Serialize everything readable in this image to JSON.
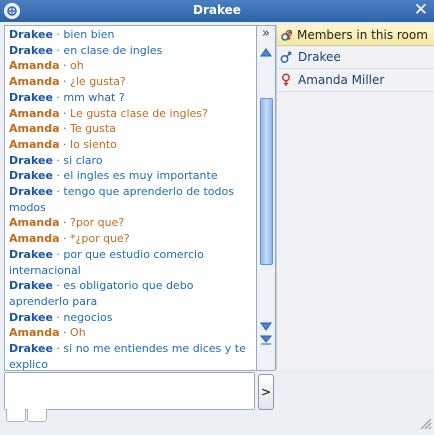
{
  "window": {
    "title": "Drakee"
  },
  "members_header": "Members in this room",
  "members": [
    {
      "name": "Drakee",
      "gender": "male"
    },
    {
      "name": "Amanda Miller",
      "gender": "female"
    }
  ],
  "messages": [
    {
      "user": "Drakee",
      "text": "bien bien"
    },
    {
      "user": "Drakee",
      "text": "en clase de ingles"
    },
    {
      "user": "Amanda",
      "text": "oh"
    },
    {
      "user": "Amanda",
      "text": "¿le gusta?"
    },
    {
      "user": "Drakee",
      "text": "mm what ?"
    },
    {
      "user": "Amanda",
      "text": "Le gusta  clase de ingles?"
    },
    {
      "user": "Amanda",
      "text": "Te gusta"
    },
    {
      "user": "Amanda",
      "text": "lo siento"
    },
    {
      "user": "Drakee",
      "text": "si claro"
    },
    {
      "user": "Drakee",
      "text": "el ingles es muy importante"
    },
    {
      "user": "Drakee",
      "text": "tengo que aprenderlo de todos modos"
    },
    {
      "user": "Amanda",
      "text": "?por que?"
    },
    {
      "user": "Amanda",
      "text": "*¿por que?"
    },
    {
      "user": "Drakee",
      "text": "por que estudio comercio internacional"
    },
    {
      "user": "Drakee",
      "text": "es obligatorio que debo aprenderlo para"
    },
    {
      "user": "Drakee",
      "text": "negocios"
    },
    {
      "user": "Amanda",
      "text": "Oh"
    },
    {
      "user": "Drakee",
      "text": "si no me entiendes me dices y te explico"
    }
  ],
  "separator": "·",
  "send_label": ">",
  "collapse_label": "»",
  "colors": {
    "drakee": "#1a55a6",
    "amanda": "#c26a1b",
    "titlebar": "#2f63a8"
  }
}
